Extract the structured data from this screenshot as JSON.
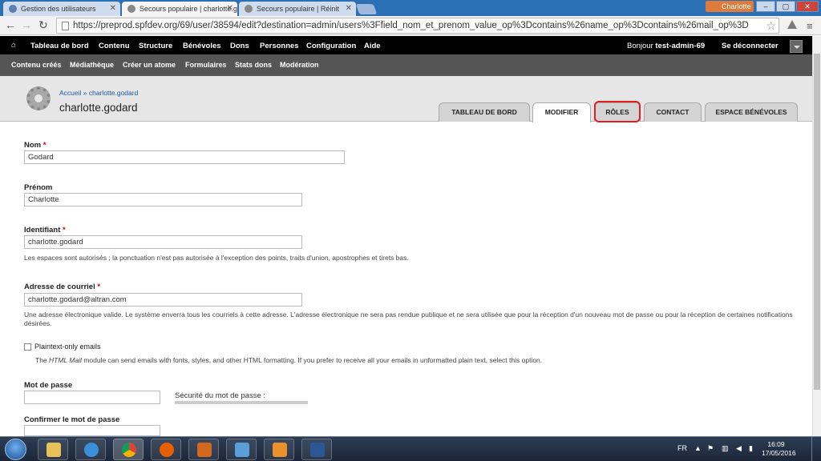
{
  "browser": {
    "tabs": [
      {
        "title": "Gestion des utilisateurs"
      },
      {
        "title": "Secours populaire | charlotte.godard"
      },
      {
        "title": "Secours populaire | Réinit"
      }
    ],
    "user_badge": "Charlotte",
    "url": "https://preprod.spfdev.org/69/user/38594/edit?destination=admin/users%3Ffield_nom_et_prenom_value_op%3Dcontains%26name_op%3Dcontains%26mail_op%3D"
  },
  "admin_menu": {
    "items": [
      "Tableau de bord",
      "Contenu",
      "Structure",
      "Bénévoles",
      "Dons",
      "Personnes",
      "Configuration",
      "Aide"
    ],
    "greeting": "Bonjour",
    "username": "test-admin-69",
    "logout": "Se déconnecter"
  },
  "shortcuts": {
    "items": [
      "Contenu créés",
      "Médiathèque",
      "Créer un atome",
      "Formulaires",
      "Stats dons",
      "Modération"
    ]
  },
  "header": {
    "breadcrumb": [
      "Accueil",
      "charlotte.godard"
    ],
    "breadcrumb_separator": "»",
    "title": "charlotte.godard",
    "tabs": [
      {
        "label": "TABLEAU DE BORD",
        "active": false
      },
      {
        "label": "MODIFIER",
        "active": true
      },
      {
        "label": "RÔLES",
        "active": false,
        "highlighted": true
      },
      {
        "label": "CONTACT",
        "active": false
      },
      {
        "label": "ESPACE BÉNÉVOLES",
        "active": false
      }
    ],
    "highlight_color": "#e01f1f"
  },
  "form": {
    "required_marker": "*",
    "nom": {
      "label": "Nom",
      "value": "Godard",
      "required": true
    },
    "prenom": {
      "label": "Prénom",
      "value": "Charlotte",
      "required": false
    },
    "identifiant": {
      "label": "Identifiant",
      "value": "charlotte.godard",
      "required": true,
      "help": "Les espaces sont autorisés ; la ponctuation n'est pas autorisée à l'exception des points, traits d'union, apostrophes et tirets bas."
    },
    "courriel": {
      "label": "Adresse de courriel",
      "value": "charlotte.godard@altran.com",
      "required": true,
      "help": "Une adresse électronique valide. Le système enverra tous les courriels à cette adresse. L'adresse électronique ne sera pas rendue publique et ne sera utilisée que pour la réception d'un nouveau mot de passe ou pour la réception de certaines notifications désirées."
    },
    "plaintext": {
      "label": "Plaintext-only emails",
      "checked": false,
      "help_prefix": "The ",
      "help_module": "HTML Mail",
      "help_suffix": " module can send emails with fonts, styles, and other HTML formatting. If you prefer to receive all your emails in unformatted plain text, select this option."
    },
    "password": {
      "label": "Mot de passe",
      "value": "",
      "strength_label": "Sécurité du mot de passe :"
    },
    "confirm_password": {
      "label": "Confirmer le mot de passe",
      "value": ""
    }
  },
  "taskbar": {
    "language": "FR",
    "time": "16:09",
    "date": "17/05/2016"
  }
}
